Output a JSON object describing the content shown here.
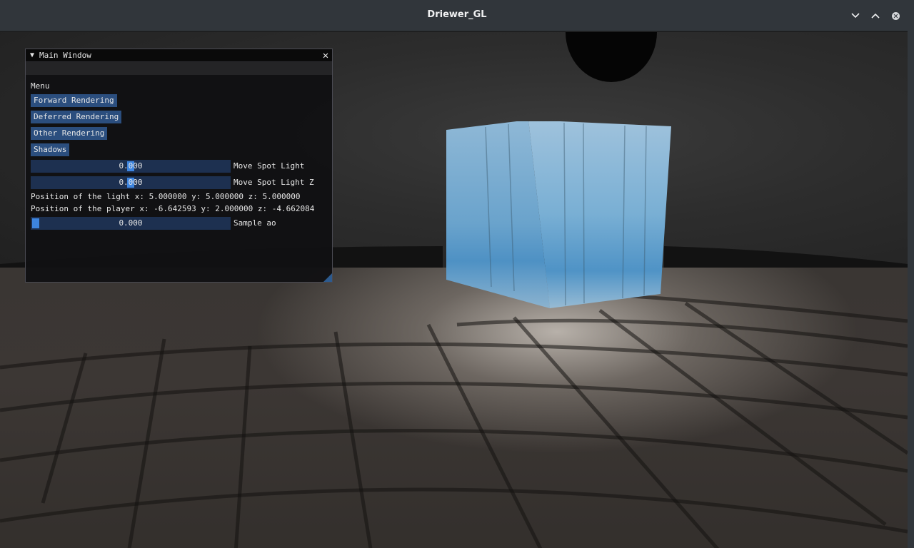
{
  "window": {
    "title": "Driewer_GL",
    "controls": {
      "minimize_icon": "chevron-down-icon",
      "maximize_icon": "chevron-up-icon",
      "close_icon": "close-icon"
    }
  },
  "imgui": {
    "title": "Main Window",
    "section_label": "Menu",
    "buttons": [
      {
        "label": "Forward Rendering"
      },
      {
        "label": "Deferred Rendering"
      },
      {
        "label": "Other Rendering"
      },
      {
        "label": "Shadows"
      }
    ],
    "sliders": [
      {
        "value": "0.000",
        "label": "Move Spot Light",
        "fraction": 0.5
      },
      {
        "value": "0.000",
        "label": "Move Spot Light Z",
        "fraction": 0.5
      }
    ],
    "info_lines": [
      "Position of the light x: 5.000000 y: 5.000000 z: 5.000000",
      "Position of the player x: -6.642593 y: 2.000000 z: -4.662084"
    ],
    "ao_slider": {
      "value": "0.000",
      "label": "Sample ao",
      "fraction": 0.0
    }
  },
  "colors": {
    "button_bg": "#2b4e7e",
    "slider_bg": "#1d3050",
    "slider_grab": "#3d85e0",
    "titlebar_bg": "#31363b"
  }
}
